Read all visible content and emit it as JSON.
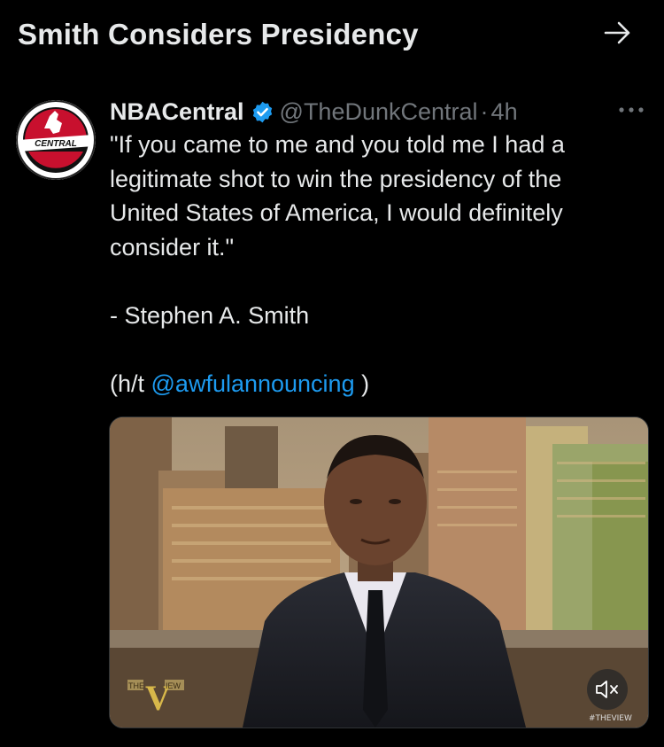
{
  "header": {
    "title": "Smith Considers Presidency",
    "arrow_icon": "arrow-right-icon"
  },
  "tweet": {
    "avatar_text": "CENTRAL",
    "author_name": "NBACentral",
    "verified_icon": "verified-badge-icon",
    "verified_color": "#1d9bf0",
    "handle": "@TheDunkCentral",
    "separator": "·",
    "time": "4h",
    "more_icon": "more-options-icon",
    "text_lines": [
      "\"If you came to me and you told me I had a",
      "legitimate shot to win the presidency of the",
      "United States of America, I would definitely",
      "consider it.\""
    ],
    "attribution": "- Stephen A. Smith",
    "ht_prefix": "(h/t ",
    "mention": "@awfulannouncing",
    "ht_suffix": " )",
    "mention_color": "#1d9bf0"
  },
  "media": {
    "type": "video",
    "logo_left": "THE",
    "logo_mid": "V",
    "logo_right": "IEW",
    "mute_icon": "speaker-muted-icon",
    "watermark": "#THEVIEW"
  }
}
